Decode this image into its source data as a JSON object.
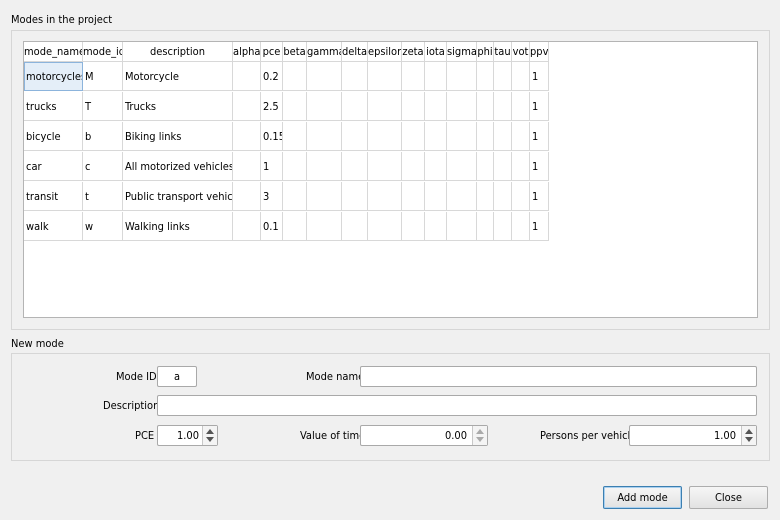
{
  "modes_group": {
    "title": "Modes in the project",
    "columns": [
      "mode_name",
      "mode_id",
      "description",
      "alpha",
      "pce",
      "beta",
      "gamma",
      "delta",
      "epsilon",
      "zeta",
      "iota",
      "sigma",
      "phi",
      "tau",
      "vot",
      "ppv"
    ],
    "rows": [
      [
        "motorcycles",
        "M",
        "Motorcycle",
        "",
        "0.2",
        "",
        "",
        "",
        "",
        "",
        "",
        "",
        "",
        "",
        "",
        "1"
      ],
      [
        "trucks",
        "T",
        "Trucks",
        "",
        "2.5",
        "",
        "",
        "",
        "",
        "",
        "",
        "",
        "",
        "",
        "",
        "1"
      ],
      [
        "bicycle",
        "b",
        "Biking links",
        "",
        "0.15",
        "",
        "",
        "",
        "",
        "",
        "",
        "",
        "",
        "",
        "",
        "1"
      ],
      [
        "car",
        "c",
        "All motorized vehicles",
        "",
        "1",
        "",
        "",
        "",
        "",
        "",
        "",
        "",
        "",
        "",
        "",
        "1"
      ],
      [
        "transit",
        "t",
        "Public transport vehicles",
        "",
        "3",
        "",
        "",
        "",
        "",
        "",
        "",
        "",
        "",
        "",
        "",
        "1"
      ],
      [
        "walk",
        "w",
        "Walking links",
        "",
        "0.1",
        "",
        "",
        "",
        "",
        "",
        "",
        "",
        "",
        "",
        "",
        "1"
      ]
    ],
    "selected_cell": "motorcycles"
  },
  "new_mode": {
    "title": "New mode",
    "mode_id_label": "Mode ID",
    "mode_id_value": "a",
    "mode_name_label": "Mode name",
    "mode_name_value": "",
    "description_label": "Description",
    "description_value": "",
    "pce_label": "PCE",
    "pce_value": "1.00",
    "vot_label": "Value of time",
    "vot_value": "0.00",
    "ppv_label": "Persons per vehicle",
    "ppv_value": "1.00"
  },
  "buttons": {
    "add_mode": "Add mode",
    "close": "Close"
  }
}
